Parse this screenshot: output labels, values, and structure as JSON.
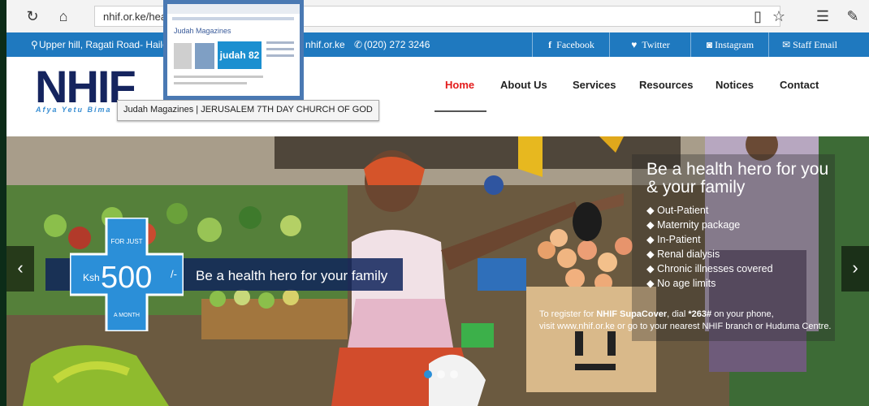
{
  "browser": {
    "url": "nhif.or.ke/healt",
    "icons": [
      "refresh-icon",
      "home-icon",
      "reading-view-icon",
      "favorite-star-icon",
      "favorites-list-icon",
      "pen-icon"
    ]
  },
  "infobar": {
    "address": "Upper hill, Ragati Road- Haile S",
    "website": "nhif.or.ke",
    "phone": "(020) 272 3246",
    "social": [
      "Facebook",
      "Twitter",
      "Instagram",
      "Staff Email"
    ]
  },
  "header": {
    "logo_text": "NHIF",
    "tagline": "Afya Yetu Bima",
    "nav": [
      "Home",
      "About Us",
      "Services",
      "Resources",
      "Notices",
      "Contact"
    ],
    "active_nav": "Home"
  },
  "tab_preview": {
    "title": "Judah Magazines | JERUSALEM 7TH DAY CHURCH OF GOD",
    "thumb_heading": "Judah Magazines",
    "thumb_logo": "judah 82"
  },
  "hero": {
    "badge_top": "FOR JUST",
    "badge_currency": "Ksh",
    "badge_amount": "500",
    "badge_suffix": "/-",
    "badge_bottom": "A MONTH",
    "promo": "Be a health hero for your family",
    "panel_title": "Be a health hero for you & your family",
    "benefits": [
      "Out-Patient",
      "Maternity package",
      "In-Patient",
      "Renal dialysis",
      "Chronic illnesses covered",
      "No age limits"
    ],
    "register_line1_pre": "To register for ",
    "register_line1_bold": "NHIF SupaCover",
    "register_line1_mid": ", dial ",
    "register_line1_code": "*263#",
    "register_line1_post": " on your phone,",
    "register_line2": "visit www.nhif.or.ke or go to your nearest NHIF branch or Huduma Centre."
  },
  "colors": {
    "infobar": "#1f79bf",
    "logo_navy": "#15245e",
    "active_nav": "#e31b1b",
    "badge_blue": "#2b8fd8"
  }
}
